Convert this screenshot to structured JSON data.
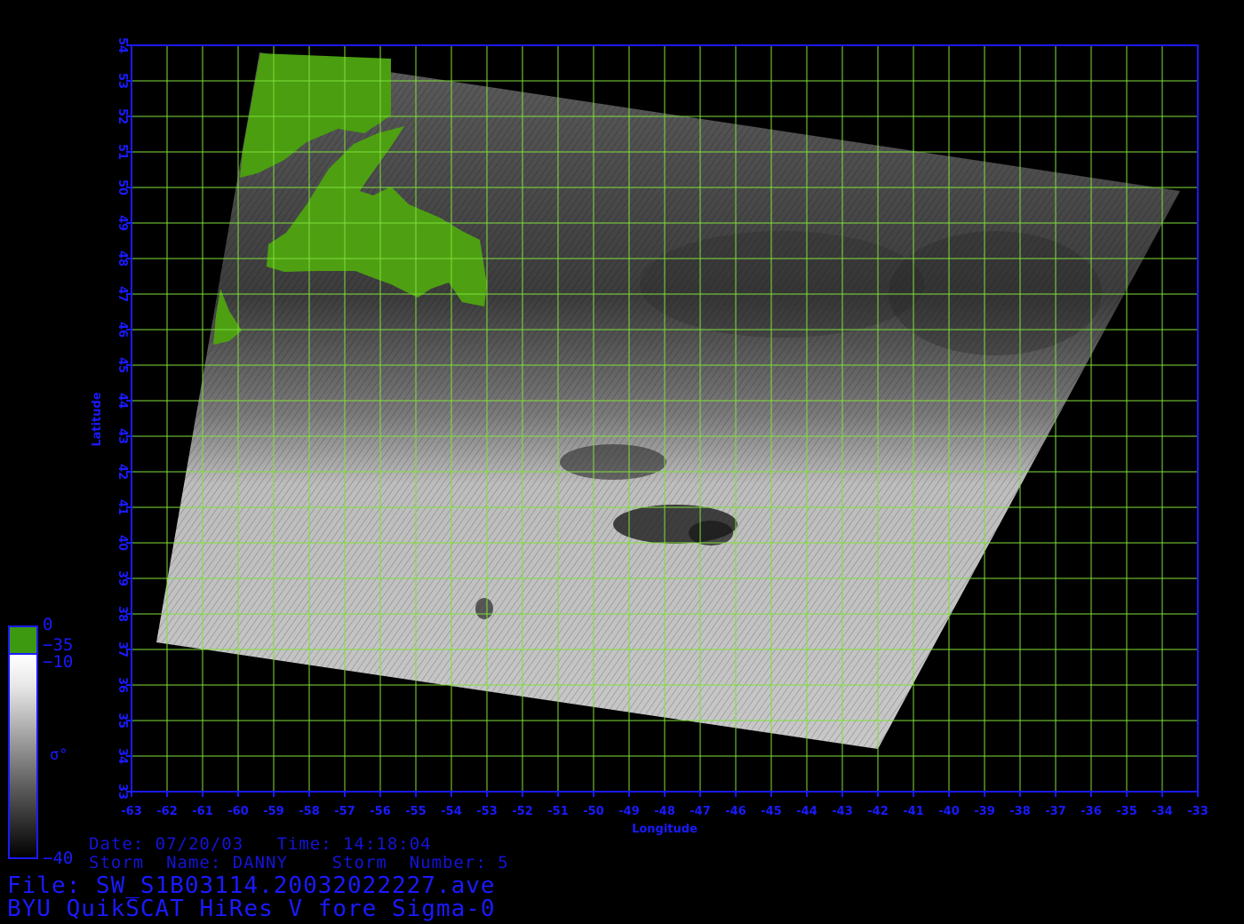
{
  "map": {
    "x_axis": {
      "label": "Longitude",
      "min": -63,
      "max": -33,
      "ticks": [
        -63,
        -62,
        -61,
        -60,
        -59,
        -58,
        -57,
        -56,
        -55,
        -54,
        -53,
        -52,
        -51,
        -50,
        -49,
        -48,
        -47,
        -46,
        -45,
        -44,
        -43,
        -42,
        -41,
        -40,
        -39,
        -38,
        -37,
        -36,
        -35,
        -34,
        -33
      ]
    },
    "y_axis": {
      "label": "Latitude",
      "min": 33,
      "max": 54,
      "ticks": [
        33,
        34,
        35,
        36,
        37,
        38,
        39,
        40,
        41,
        42,
        43,
        44,
        45,
        46,
        47,
        48,
        49,
        50,
        51,
        52,
        53,
        54
      ]
    },
    "grid": true,
    "colors": {
      "axis": "#1a1aff",
      "grid": "#7fe03a",
      "land": "#4fa010",
      "background": "#000000"
    },
    "swath_corners_lonlat": [
      [
        -59.4,
        53.8
      ],
      [
        -33.5,
        49.9
      ],
      [
        -42.0,
        34.2
      ],
      [
        -62.3,
        37.2
      ]
    ],
    "land_regions": [
      "Newfoundland",
      "Labrador",
      "Cape Breton / Nova Scotia"
    ]
  },
  "colorbar": {
    "symbol": "σ°",
    "land_top": "0",
    "land_bottom": "−35",
    "ocean_top": "−10",
    "ocean_bottom": "−40",
    "colors": {
      "land": "#3d9a10",
      "high": "#ffffff",
      "low": "#000000"
    }
  },
  "info": {
    "date_line": "Date: 07/20/03   Time: 14:18:04",
    "storm_line": "Storm  Name: DANNY    Storm  Number: 5",
    "file_line": "File: SW_S1B03114.20032022227.ave",
    "product_line": "BYU QuikSCAT HiRes V fore Sigma-0"
  }
}
